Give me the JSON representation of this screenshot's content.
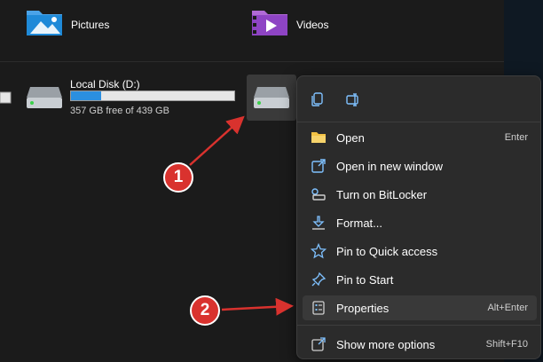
{
  "folders": [
    {
      "label": "Pictures",
      "icon": "pictures-folder-icon"
    },
    {
      "label": "Videos",
      "icon": "videos-folder-icon"
    }
  ],
  "drives": [
    {
      "label": "Local Disk (D:)",
      "free_text": "357 GB free of 439 GB",
      "used_fraction": 0.187
    }
  ],
  "context_menu": {
    "top_actions": [
      {
        "icon": "copy-icon"
      },
      {
        "icon": "rename-icon"
      }
    ],
    "items": [
      {
        "label": "Open",
        "shortcut": "Enter",
        "icon": "open-folder-icon"
      },
      {
        "label": "Open in new window",
        "shortcut": "",
        "icon": "open-new-window-icon"
      },
      {
        "label": "Turn on BitLocker",
        "shortcut": "",
        "icon": "bitlocker-key-icon"
      },
      {
        "label": "Format...",
        "shortcut": "",
        "icon": "format-icon"
      },
      {
        "label": "Pin to Quick access",
        "shortcut": "",
        "icon": "star-icon"
      },
      {
        "label": "Pin to Start",
        "shortcut": "",
        "icon": "pin-icon"
      },
      {
        "label": "Properties",
        "shortcut": "Alt+Enter",
        "icon": "properties-icon"
      },
      {
        "label": "Show more options",
        "shortcut": "Shift+F10",
        "icon": "more-options-icon"
      }
    ]
  },
  "annotations": [
    {
      "number": "1"
    },
    {
      "number": "2"
    }
  ],
  "colors": {
    "background": "#1b1b1b",
    "menu_background": "#2b2b2b",
    "accent_blue": "#2b8fe0",
    "annotation_red": "#d9322e"
  }
}
